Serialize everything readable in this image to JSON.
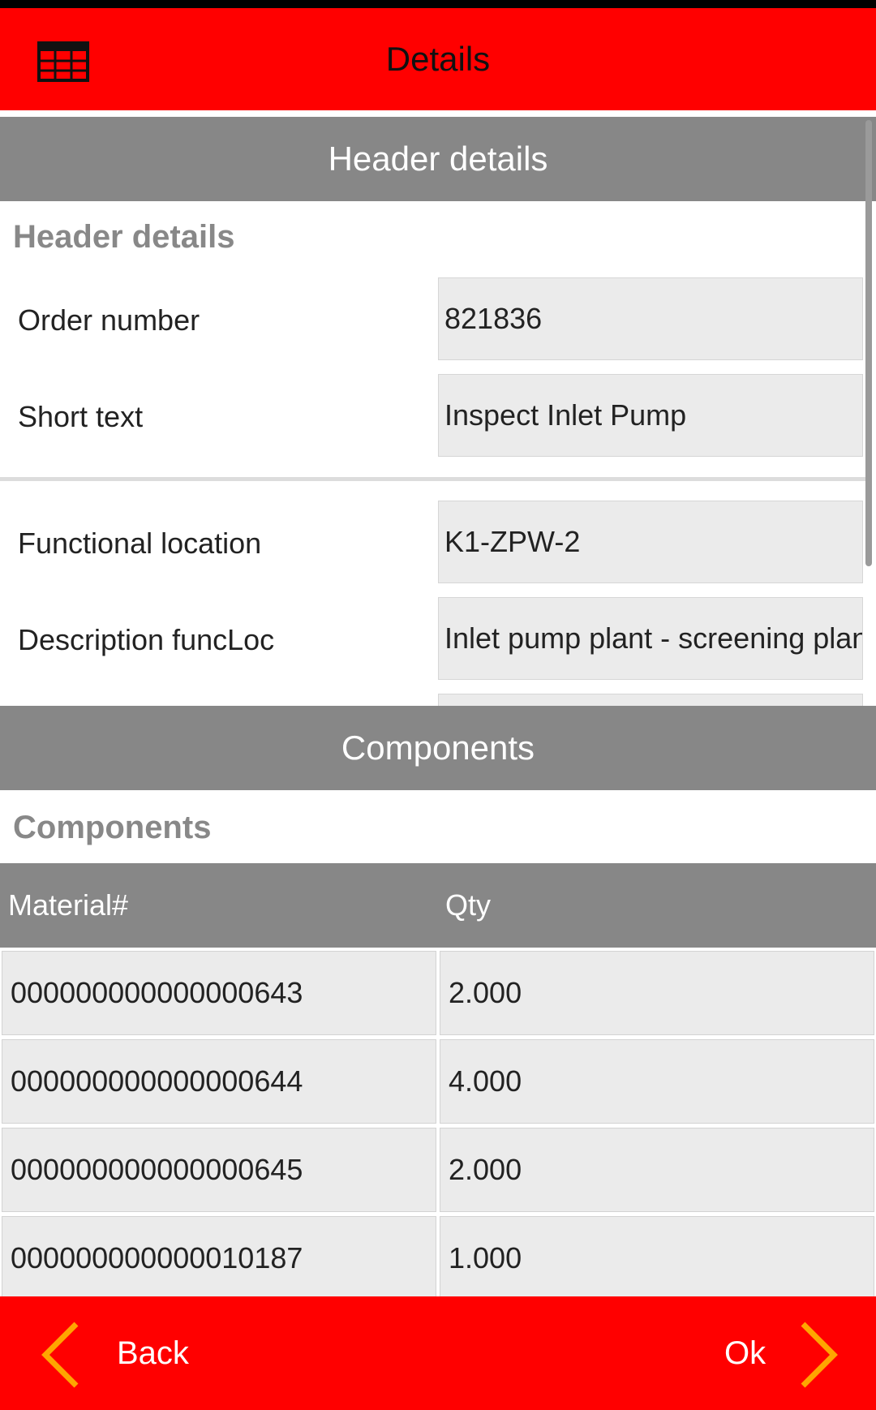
{
  "app": {
    "title": "Details",
    "brand_color": "#ff0000",
    "header_gray": "#878787"
  },
  "header_section": {
    "title": "Header details",
    "group_label": "Header details",
    "fields": [
      {
        "label": "Order number",
        "value": "821836"
      },
      {
        "label": "Short text",
        "value": "Inspect Inlet Pump"
      },
      {
        "label": "Functional location",
        "value": "K1-ZPW-2"
      },
      {
        "label": "Description funcLoc",
        "value": "Inlet pump plant - screening plant"
      }
    ]
  },
  "components_section": {
    "title": "Components",
    "group_label": "Components",
    "columns": [
      "Material#",
      "Qty"
    ],
    "rows": [
      {
        "material": "000000000000000643",
        "qty": "2.000"
      },
      {
        "material": "000000000000000644",
        "qty": "4.000"
      },
      {
        "material": "000000000000000645",
        "qty": "2.000"
      },
      {
        "material": "000000000000010187",
        "qty": "1.000"
      }
    ]
  },
  "footer": {
    "back_label": "Back",
    "ok_label": "Ok",
    "chevron_color": "#ffa500"
  },
  "icons": {
    "menu": "grid-icon",
    "back": "chevron-left-icon",
    "ok": "chevron-right-icon"
  }
}
